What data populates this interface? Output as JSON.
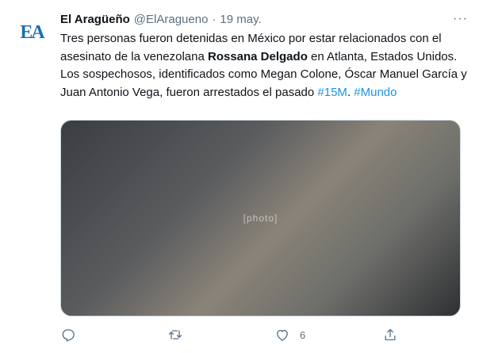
{
  "tweet": {
    "account": {
      "display_name": "El Aragüeño",
      "handle": "@ElAragueno",
      "separator": "·",
      "date": "19 may.",
      "avatar_text": "EA",
      "more_label": "···"
    },
    "text": {
      "part1": "Tres personas fueron detenidas en México por estar relacionados con el asesinato de la venezolana ",
      "bold_name": "Rossana Delgado",
      "part2": " en Atlanta, Estados Unidos. Los sospechosos, identificados como Megan Colone,  Óscar Manuel García  y Juan Antonio Vega,  fueron arrestados el pasado ",
      "hashtag1": "#15M",
      "part3": ". ",
      "hashtag2": "#Mundo"
    },
    "media": {
      "placeholder": "[photo]"
    },
    "actions": {
      "reply_icon": "reply-icon",
      "retweet_icon": "retweet-icon",
      "like_icon": "heart-icon",
      "like_count": "6",
      "share_icon": "share-icon"
    }
  },
  "colors": {
    "text": "#0f1419",
    "muted": "#5b7083",
    "link": "#1b95e0",
    "logo": "#1a6fb0"
  }
}
